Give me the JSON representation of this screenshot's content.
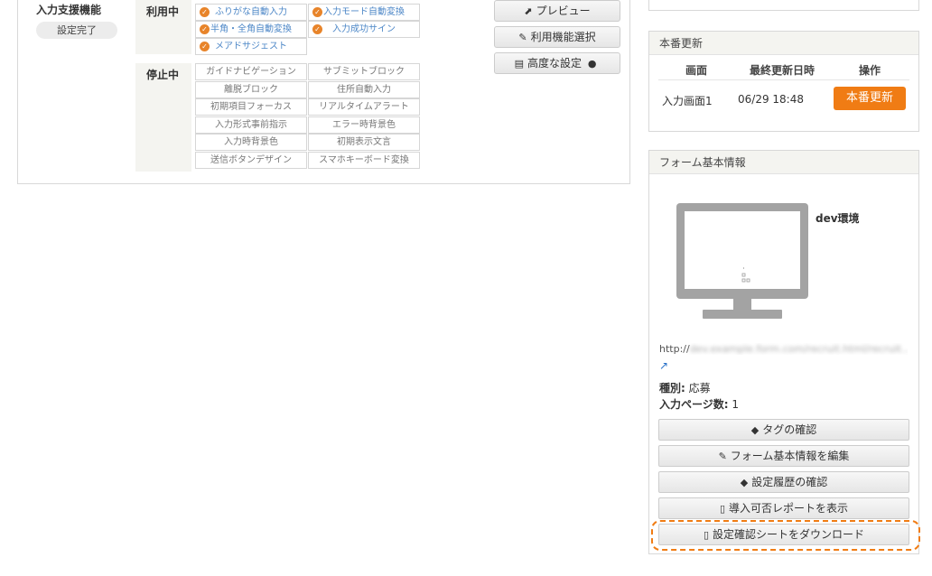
{
  "feature": {
    "title": "入力支援機能",
    "status": "設定完了"
  },
  "in_use": {
    "label": "利用中",
    "items": [
      "ふりがな自動入力",
      "入力モード自動変換",
      "半角・全角自動変換",
      "入力成功サイン",
      "メアドサジェスト"
    ]
  },
  "stopped": {
    "label": "停止中",
    "items": [
      "ガイドナビゲーション",
      "サブミットブロック",
      "離脱ブロック",
      "住所自動入力",
      "初期項目フォーカス",
      "リアルタイムアラート",
      "入力形式事前指示",
      "エラー時背景色",
      "入力時背景色",
      "初期表示文言",
      "送信ボタンデザイン",
      "スマホキーボード変換"
    ]
  },
  "actions": {
    "preview": "プレビュー",
    "select_features": "利用機能選択",
    "advanced": "高度な設定"
  },
  "release": {
    "title": "本番更新",
    "headers": [
      "画面",
      "最終更新日時",
      "操作"
    ],
    "row": {
      "screen": "入力画面1",
      "updated": "06/29 18:48",
      "button": "本番更新"
    }
  },
  "form_info": {
    "title": "フォーム基本情報",
    "env": "dev環境",
    "url": "http://",
    "url_masked": "dev.example.form.com/recruit.html/recruit...",
    "type_label": "種別:",
    "type_value": "応募",
    "pages_label": "入力ページ数:",
    "pages_value": "1",
    "buttons": {
      "tag": "タグの確認",
      "edit": "フォーム基本情報を編集",
      "history": "設定履歴の確認",
      "report": "導入可否レポートを表示",
      "download": "設定確認シートをダウンロード"
    }
  },
  "colors": {
    "accent": "#f07c14",
    "link": "#4d87c7"
  }
}
